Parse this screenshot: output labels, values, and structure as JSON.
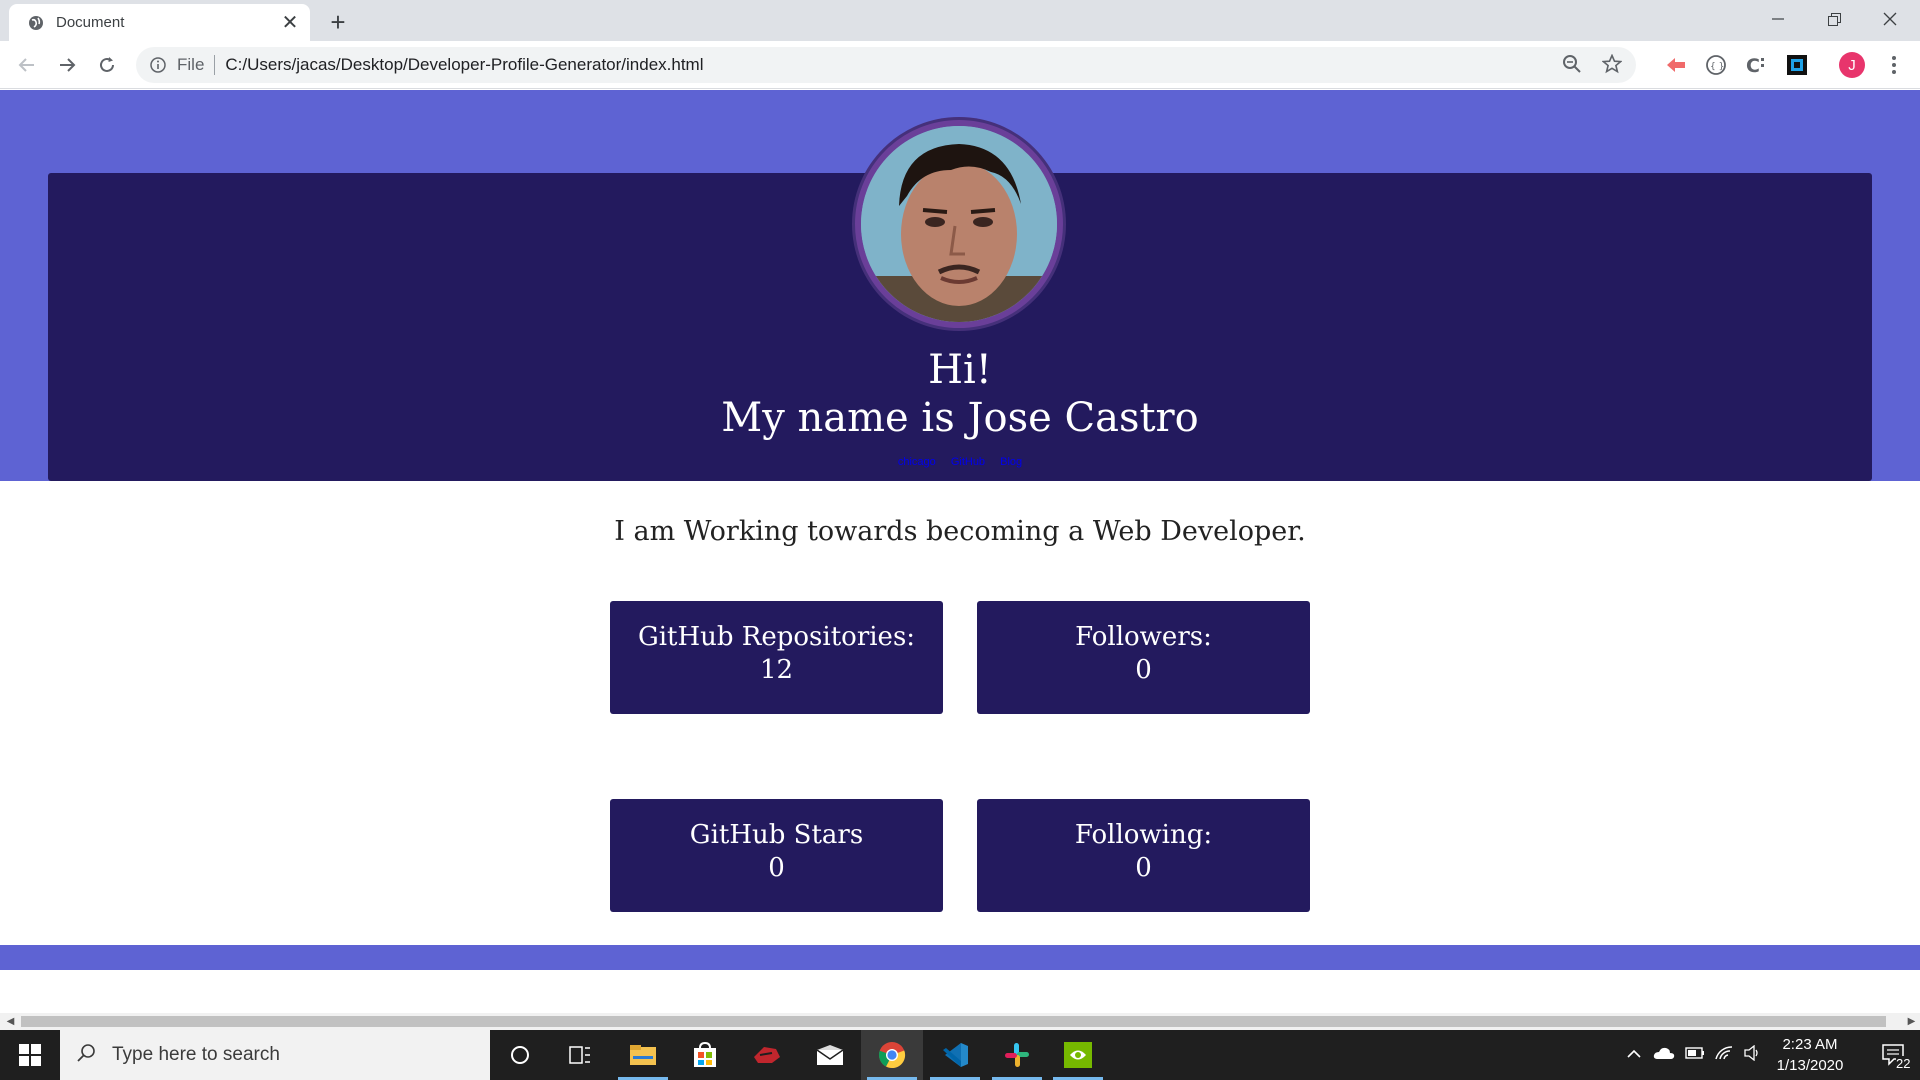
{
  "browser": {
    "tab_title": "Document",
    "address_scheme": "File",
    "address_url": "C:/Users/jacas/Desktop/Developer-Profile-Generator/index.html",
    "profile_initial": "J"
  },
  "page": {
    "greeting": "Hi!",
    "name_line": "My name is Jose Castro",
    "links": [
      "chicago",
      "GitHub",
      "Blog"
    ],
    "bio": "I am Working towards becoming a Web Developer.",
    "stats": [
      {
        "label": "GitHub Repositories:",
        "value": "12"
      },
      {
        "label": "Followers:",
        "value": "0"
      },
      {
        "label": "GitHub Stars",
        "value": "0"
      },
      {
        "label": "Following:",
        "value": "0"
      }
    ],
    "colors": {
      "hero_bg": "#5e63d3",
      "card_bg": "#231a5e",
      "photo_ring": "#6a3f99"
    }
  },
  "taskbar": {
    "search_placeholder": "Type here to search",
    "time": "2:23 AM",
    "date": "1/13/2020",
    "notification_count": "22"
  }
}
